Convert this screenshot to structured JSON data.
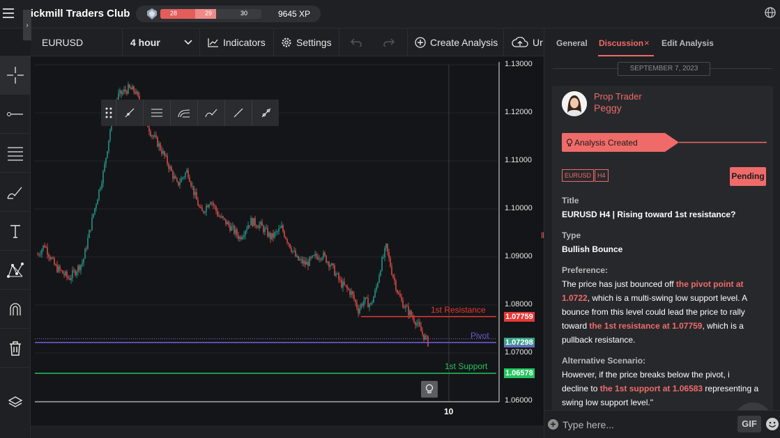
{
  "app": {
    "title": "Tickmill Traders Club",
    "xp": {
      "level_current": "28",
      "level_mid": "29",
      "level_next": "30",
      "progress": 0.55,
      "total": "9645 XP"
    }
  },
  "chart_toolbar": {
    "symbol": "EURUSD",
    "timeframe": "4 hour",
    "indicators": "Indicators",
    "settings": "Settings",
    "create_analysis": "Create Analysis",
    "upload": "Ur"
  },
  "left_tools": [
    "crosshair-icon",
    "horizontal-line-icon",
    "fib-lines-icon",
    "brush-icon",
    "text-icon",
    "pattern-icon",
    "magnet-icon",
    "trash-icon",
    "layers-icon"
  ],
  "float_tools": [
    "drag-handle-icon",
    "ray-icon",
    "parallel-channel-icon",
    "pitchfork-icon",
    "brush-icon",
    "trend-line-icon",
    "extended-line-icon"
  ],
  "chart_data": {
    "type": "candlestick",
    "symbol": "EURUSD",
    "ylim": [
      1.06,
      1.13
    ],
    "yticks": [
      "1.13000",
      "1.12000",
      "1.11000",
      "1.10000",
      "1.09000",
      "1.08000",
      "1.07000",
      "1.06000"
    ],
    "xticks": [
      "10"
    ],
    "levels": [
      {
        "name": "1st Resistance",
        "value": 1.07759,
        "tag": "1.07759",
        "color": "#e53935"
      },
      {
        "name": "Pivot",
        "value": 1.0722,
        "tag": "1.07298",
        "color": "#6a5acd"
      },
      {
        "name": "1st Support",
        "value": 1.06578,
        "tag": "1.06578",
        "color": "#22c55e"
      }
    ],
    "last_price": 1.07298,
    "up_color": "#26a69a",
    "down_color": "#ef5350"
  },
  "panel": {
    "tabs": [
      "General",
      "Discussion",
      "Edit Analysis"
    ],
    "active_tab": "Discussion",
    "date": "SEPTEMBER 7, 2023",
    "post": {
      "role": "Prop Trader",
      "name": "Peggy",
      "banner": "Analysis Created",
      "chips": [
        "EURUSD",
        "H4"
      ],
      "status": "Pending",
      "title_label": "Title",
      "title": "EURUSD H4 | Rising toward 1st resistance?",
      "type_label": "Type",
      "type": "Bullish Bounce",
      "pref_label": "Preference:",
      "pref_parts": [
        "The price has just bounced off ",
        "the pivot point at 1.0722",
        ", which is a multi-swing low support level. A bounce from this level could lead the price to rally toward ",
        "the 1st resistance at 1.07759",
        ", which is a pullback resistance."
      ],
      "alt_label": "Alternative Scenario:",
      "alt_parts": [
        " However, if the price breaks below the pivot, i",
        "decline to ",
        "the 1st support at 1.06583",
        " representing a swing low support level.\""
      ]
    },
    "input_placeholder": "Type here...",
    "gif": "GIF"
  },
  "accent": "#ef6b69"
}
